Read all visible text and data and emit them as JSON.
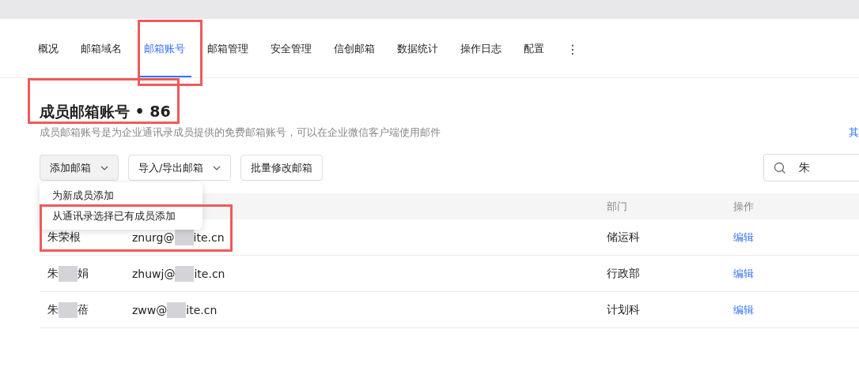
{
  "tabs": [
    {
      "label": "概况",
      "selected": false
    },
    {
      "label": "邮箱域名",
      "selected": false
    },
    {
      "label": "邮箱账号",
      "selected": true
    },
    {
      "label": "邮箱管理",
      "selected": false
    },
    {
      "label": "安全管理",
      "selected": false
    },
    {
      "label": "信创邮箱",
      "selected": false
    },
    {
      "label": "数据统计",
      "selected": false
    },
    {
      "label": "操作日志",
      "selected": false
    },
    {
      "label": "配置",
      "selected": false
    }
  ],
  "more_icon": "⋮",
  "title": "成员邮箱账号 • 86",
  "subtitle": "成员邮箱账号是为企业通讯录成员提供的免费邮箱账号，可以在企业微信客户端使用邮件",
  "side_link": "其",
  "toolbar": [
    {
      "label": "添加邮箱",
      "dropdown": true,
      "expanded": true
    },
    {
      "label": "导入/导出邮箱",
      "dropdown": true,
      "expanded": false
    },
    {
      "label": "批量修改邮箱",
      "dropdown": false,
      "expanded": false
    }
  ],
  "dropdown_menu": [
    "为新成员添加",
    "从通讯录选择已有成员添加"
  ],
  "search": {
    "value": "朱"
  },
  "table": {
    "columns": [
      "部门",
      "操作"
    ],
    "rows": [
      {
        "name_start": "朱荣根",
        "name_end": "",
        "email_start": "znurg@",
        "email_end": "ite.cn",
        "department": "储运科",
        "action": "编辑"
      },
      {
        "name_start": "朱",
        "name_end": "娟",
        "email_start": "zhuwj@",
        "email_end": "ite.cn",
        "department": "行政部",
        "action": "编辑"
      },
      {
        "name_start": "朱",
        "name_end": "蓓",
        "email_start": "zww@",
        "email_end": "ite.cn",
        "department": "计划科",
        "action": "编辑"
      }
    ]
  }
}
